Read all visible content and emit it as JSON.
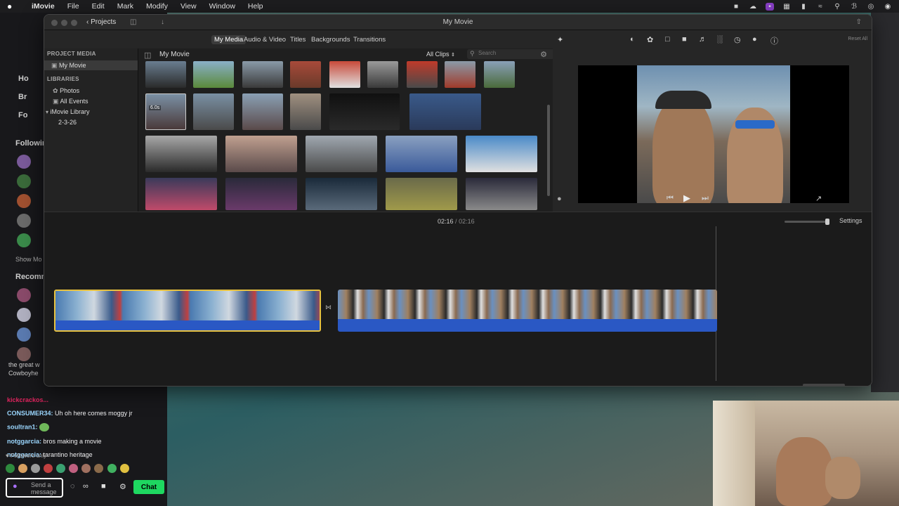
{
  "menubar": {
    "apple": "",
    "app_name": "iMovie",
    "items": [
      "File",
      "Edit",
      "Mark",
      "Modify",
      "View",
      "Window",
      "Help"
    ]
  },
  "imovie": {
    "title": "My Movie",
    "projects_label": "Projects",
    "media_tabs": [
      {
        "label": "My Media",
        "active": true
      },
      {
        "label": "Audio & Video",
        "active": false
      },
      {
        "label": "Titles",
        "active": false
      },
      {
        "label": "Backgrounds",
        "active": false
      },
      {
        "label": "Transitions",
        "active": false
      }
    ],
    "reset_all": "Reset All",
    "sidebar": {
      "project_media_header": "PROJECT MEDIA",
      "my_movie": "My Movie",
      "libraries_header": "LIBRARIES",
      "photos": "Photos",
      "all_events": "All Events",
      "imovie_library": "iMovie Library",
      "event_date": "2-3-26"
    },
    "browser": {
      "title": "My Movie",
      "filter": "All Clips",
      "search_placeholder": "Search",
      "thumb_duration": "6.0s"
    },
    "timeline": {
      "current_time": "02:16",
      "total_time": "02:16",
      "separator": "/",
      "settings_label": "Settings"
    }
  },
  "chat": {
    "sidebar_following": "Following",
    "sidebar_recommended": "Recomm",
    "show_more": "Show Mo",
    "sidebar_labels": [
      "Ho",
      "Br",
      "Fo"
    ],
    "partial_lines": [
      "the great w",
      "Cowboyhe"
    ],
    "messages": [
      {
        "user": "kickcrackos...",
        "color": "#e0245e",
        "text": ""
      },
      {
        "user": "CONSUMER34:",
        "color": "#9bd7ff",
        "text": "Uh oh here comes moggy jr"
      },
      {
        "user": "soultran1:",
        "color": "#9bd7ff",
        "text": ""
      },
      {
        "user": "notggarcia:",
        "color": "#9bd7ff",
        "text": "bros making a movie"
      },
      {
        "user": "notggarcia:",
        "color": "#9bd7ff",
        "text": "tarantino heritage"
      }
    ],
    "followers_only": "Followers only",
    "send_placeholder": "Send a message",
    "chat_button": "Chat"
  },
  "colors": {
    "accent_green": "#1ed760",
    "clip_audio_blue": "#2a58c4",
    "selected_clip_border": "#e8c240"
  }
}
